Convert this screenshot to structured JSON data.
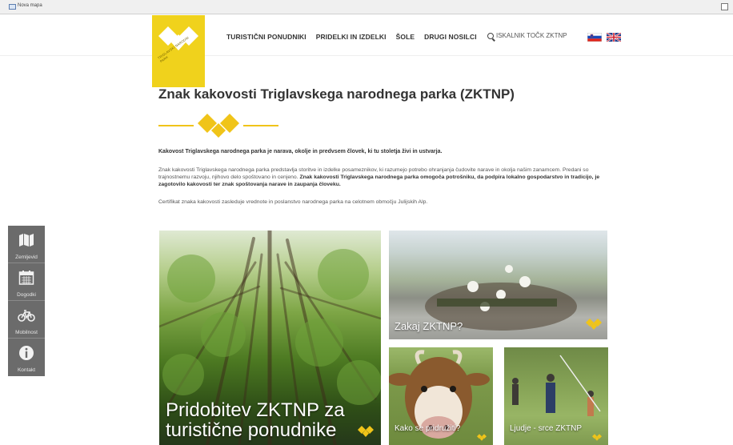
{
  "browser": {
    "tab_title": "Nova mapa"
  },
  "logo": {
    "text": "TRIGLAVSKI NARODNI PARK",
    "alt": "ZKTNP logo"
  },
  "nav": {
    "items": [
      "TURISTIČNI PONUDNIKI",
      "PRIDELKI IN IZDELKI",
      "ŠOLE",
      "DRUGI NOSILCI"
    ]
  },
  "search": {
    "label": "ISKALNIK TOČK ZKTNP",
    "icon": "search-icon"
  },
  "languages": [
    {
      "code": "sl",
      "icon": "slovenia-flag-icon"
    },
    {
      "code": "en",
      "icon": "uk-flag-icon"
    }
  ],
  "page": {
    "title": "Znak kakovosti Triglavskega narodnega parka (ZKTNP)",
    "lead": "Kakovost Triglavskega narodnega parka je narava, okolje in predvsem človek, ki tu stoletja živi in ustvarja.",
    "body_1": "Znak kakovosti Triglavskega narodnega parka predstavlja storitve in izdelke posameznikov, ki razumejo potrebo ohranjanja čudovite narave in okolja našim zanamcem. Predani so trajnostnemu razvoju, njihovo delo spoštovano in cenjeno.",
    "body_2": "Znak kakovosti Triglavskega narodnega parka omogoča potrošniku, da podpira lokalno gospodarstvo in tradicijo, je zagotovilo kakovosti ter znak spoštovanja narave in zaupanja človeku.",
    "certificate": "Certifikat znaka kakovosti zasleduje vrednote in poslanstvo narodnega parka na celotnem območju Julijskih Alp."
  },
  "sidebar": {
    "items": [
      {
        "label": "Zemljevid",
        "icon": "map-icon"
      },
      {
        "label": "Dogodki",
        "icon": "calendar-icon"
      },
      {
        "label": "Mobilnost",
        "icon": "bicycle-icon"
      },
      {
        "label": "Kontakt",
        "icon": "info-icon"
      }
    ]
  },
  "tiles": {
    "forest": {
      "caption": "Pridobitev ZKTNP za turistične ponudnike"
    },
    "flowers": {
      "caption": "Zakaj ZKTNP?"
    },
    "cow": {
      "caption": "Kako se pridružiti?"
    },
    "people": {
      "caption": "Ljudje - srce ZKTNP"
    }
  },
  "colors": {
    "accent": "#f0c419",
    "sidebar": "#6b6b6b",
    "logo_bg": "#f0d21c"
  }
}
